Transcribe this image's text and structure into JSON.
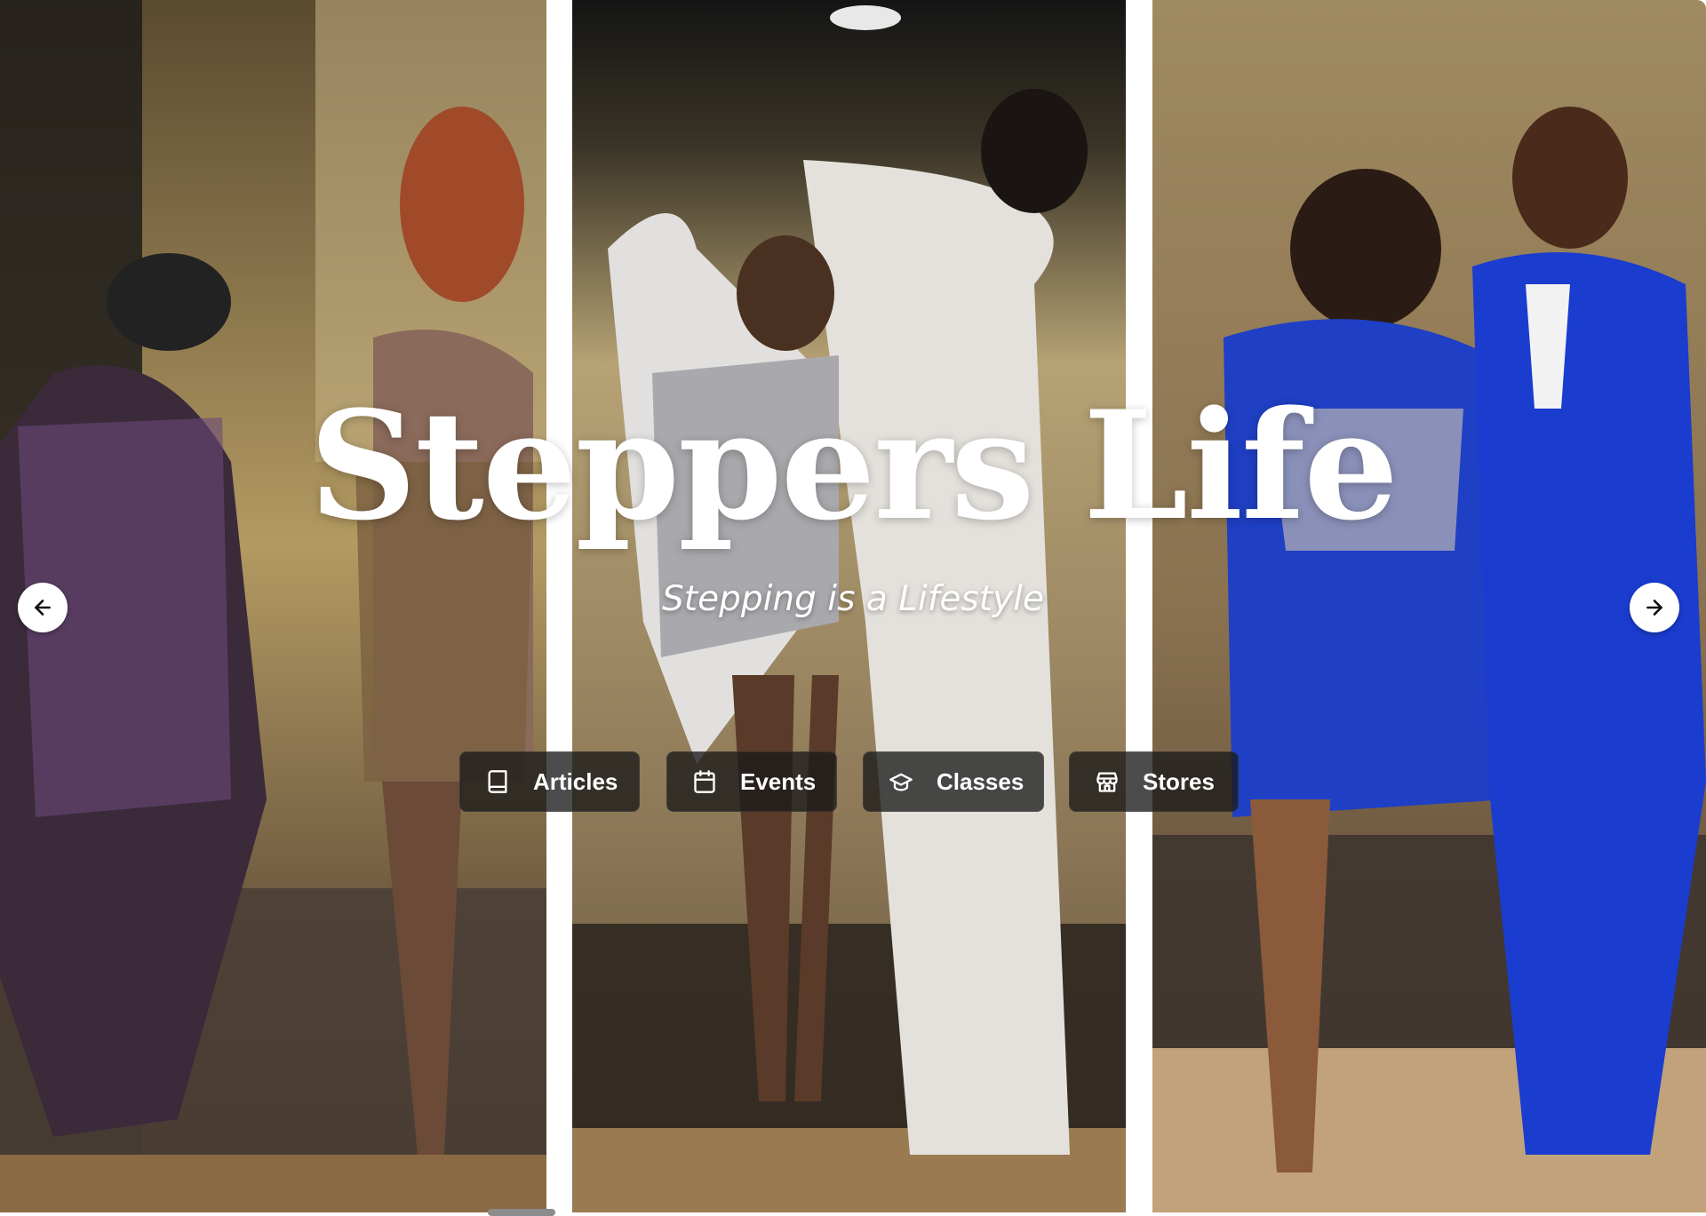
{
  "hero": {
    "title": "Steppers Life",
    "subtitle": "Stepping is a Lifestyle"
  },
  "carousel": {
    "prev_icon": "arrow-left-icon",
    "next_icon": "arrow-right-icon"
  },
  "nav": {
    "items": [
      {
        "label": "Articles",
        "icon": "book-icon"
      },
      {
        "label": "Events",
        "icon": "calendar-icon"
      },
      {
        "label": "Classes",
        "icon": "graduation-cap-icon"
      },
      {
        "label": "Stores",
        "icon": "store-icon"
      }
    ]
  },
  "colors": {
    "button_bg": "#191919",
    "text": "#ffffff",
    "arrow_bg": "#ffffff"
  }
}
